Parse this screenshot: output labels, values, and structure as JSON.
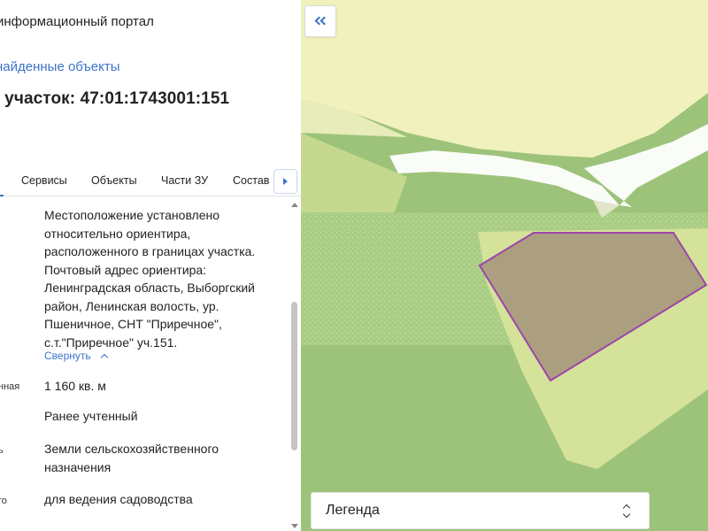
{
  "header": {
    "portal_title": "информационный портал",
    "back_link": "найденные объекты",
    "parcel_title": "й участок: 47:01:1743001:151"
  },
  "tabs": [
    {
      "label": "Сервисы"
    },
    {
      "label": "Объекты"
    },
    {
      "label": "Части ЗУ"
    },
    {
      "label": "Состав"
    }
  ],
  "attributes": {
    "address_value": "Местоположение установлено относительно ориентира, расположенного в границах участка. Почтовый адрес ориентира: Ленинградская область, Выборгский район, Ленинская волость, ур. Пшеничное, СНТ \"Приречное\", с.т.\"Приречное\" уч.151.",
    "collapse_label": "Свернуть",
    "area_label": "нная",
    "area_value": "1 160 кв. м",
    "status_value": "Ранее учтенный",
    "category_label": "ь",
    "category_value": "Земли сельскохозяйственного назначения",
    "use_label": "го",
    "use_value": "для ведения садоводства"
  },
  "map": {
    "legend_label": "Легенда",
    "colors": {
      "accent": "#3b73c9",
      "parcel_outline": "#9b3dac",
      "parcel_fill": "#a99c7e",
      "farmland": "#9dc37a",
      "light_zone": "#f1f1bd",
      "yellow_zone": "#d9e29a",
      "road": "#ffffff"
    },
    "icons": [
      "double-chevron-left-icon",
      "chevron-up-down-icon",
      "caret-right-icon"
    ]
  }
}
